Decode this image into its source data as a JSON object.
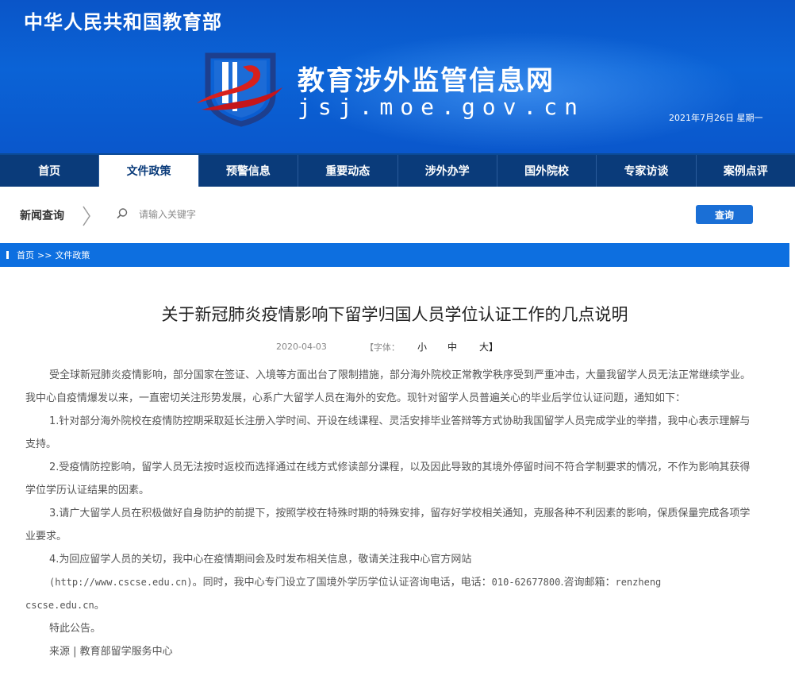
{
  "header": {
    "ministry": "中华人民共和国教育部",
    "site_title": "教育涉外监管信息网",
    "site_domain": "jsj.moe.gov.cn",
    "date": "2021年7月26日 星期一",
    "colors": {
      "banner": "#0b63d6",
      "nav": "#0a3b7a",
      "logo_red": "#d9201c"
    }
  },
  "nav": {
    "items": [
      {
        "label": "首页"
      },
      {
        "label": "文件政策"
      },
      {
        "label": "预警信息"
      },
      {
        "label": "重要动态"
      },
      {
        "label": "涉外办学"
      },
      {
        "label": "国外院校"
      },
      {
        "label": "专家访谈"
      },
      {
        "label": "案例点评"
      }
    ],
    "active": "文件政策"
  },
  "search": {
    "label": "新闻查询",
    "placeholder": "请输入关键字",
    "button": "查询",
    "icon": "search-icon"
  },
  "breadcrumb": {
    "home": "首页",
    "separator": ">>",
    "current": "文件政策"
  },
  "article": {
    "title": "关于新冠肺炎疫情影响下留学归国人员学位认证工作的几点说明",
    "date": "2020-04-03",
    "font_size_prefix": "【字体：",
    "size_small": "小",
    "size_medium": "中",
    "size_large": "大】",
    "paragraphs": {
      "intro": "受全球新冠肺炎疫情影响，部分国家在签证、入境等方面出台了限制措施，部分海外院校正常教学秩序受到严重冲击，大量我留学人员无法正常继续学业。我中心自疫情爆发以来，一直密切关注形势发展，心系广大留学人员在海外的安危。现针对留学人员普遍关心的毕业后学位认证问题，通知如下：",
      "p1": "1.针对部分海外院校在疫情防控期采取延长注册入学时间、开设在线课程、灵活安排毕业答辩等方式协助我国留学人员完成学业的举措，我中心表示理解与支持。",
      "p2": "2.受疫情防控影响，留学人员无法按时返校而选择通过在线方式修读部分课程，以及因此导致的其境外停留时间不符合学制要求的情况，不作为影响其获得学位学历认证结果的因素。",
      "p3": "3.请广大留学人员在积极做好自身防护的前提下，按照学校在特殊时期的特殊安排，留存好学校相关通知，克服各种不利因素的影响，保质保量完成各项学业要求。",
      "p4_line1": "4.为回应留学人员的关切，我中心在疫情期间会及时发布相关信息，敬请关注我中心官方网站",
      "p4_url": "(http://www.cscse.edu.cn)",
      "p4_rest": "。同时，我中心专门设立了国境外学历学位认证咨询电话，电话：",
      "p4_phone": "010-62677800",
      "p4_mail_label": ".咨询邮箱：",
      "p4_mail_user": "renzheng",
      "p4_mail_domain": "cscse.edu.cn",
      "p4_end": "。",
      "closing": "特此公告。",
      "source": "来源 | 教育部留学服务中心"
    }
  }
}
